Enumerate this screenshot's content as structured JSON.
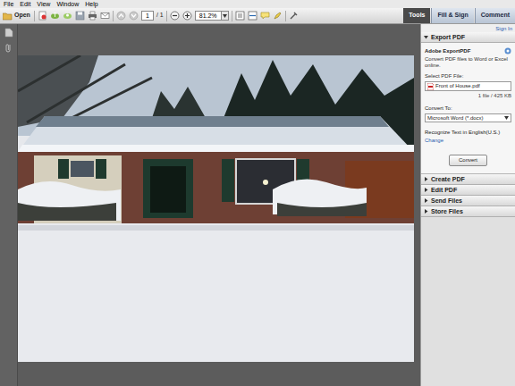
{
  "menu": [
    "File",
    "Edit",
    "View",
    "Window",
    "Help"
  ],
  "toolbar": {
    "open": "Open",
    "page": "1",
    "page_total": "/ 1",
    "zoom": "81.2%"
  },
  "tabs": [
    {
      "label": "Tools",
      "selected": true
    },
    {
      "label": "Fill & Sign",
      "selected": false
    },
    {
      "label": "Comment",
      "selected": false
    }
  ],
  "panel": {
    "sign_in": "Sign In",
    "sections": [
      {
        "label": "Export PDF",
        "expanded": true
      },
      {
        "label": "Create PDF",
        "expanded": false
      },
      {
        "label": "Edit PDF",
        "expanded": false
      },
      {
        "label": "Send Files",
        "expanded": false
      },
      {
        "label": "Store Files",
        "expanded": false
      }
    ],
    "export": {
      "title": "Adobe ExportPDF",
      "description": "Convert PDF files to Word or Excel online.",
      "select_label": "Select PDF File:",
      "file": "Front of House.pdf",
      "file_info": "1 file / 425 KB",
      "convert_to_label": "Convert To:",
      "format": "Microsoft Word (*.docx)",
      "recognize": "Recognize Text in English(U.S.)",
      "change": "Change",
      "button": "Convert"
    }
  }
}
